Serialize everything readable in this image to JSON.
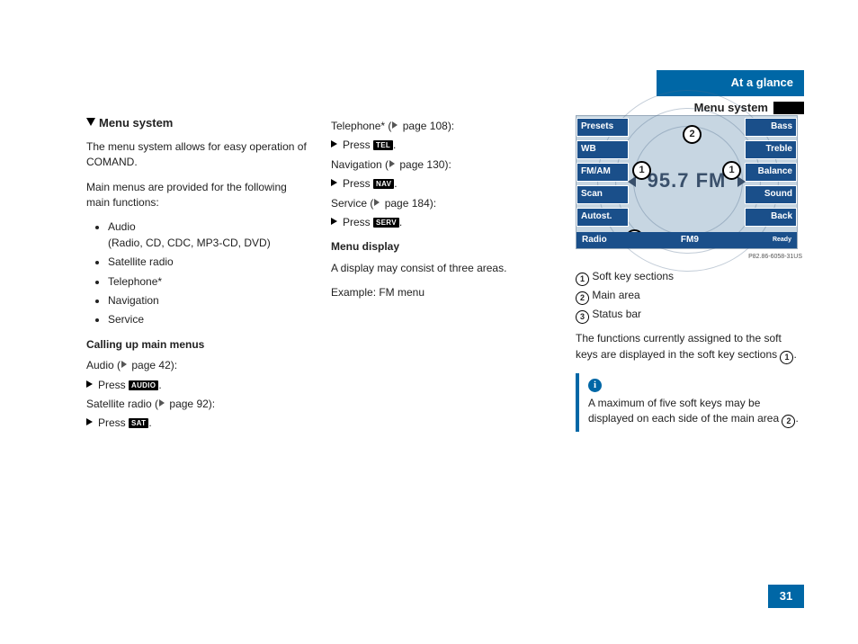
{
  "header": {
    "title": "At a glance",
    "subtitle": "Menu system"
  },
  "section": {
    "title": "Menu system",
    "intro": "The menu system allows for easy operation of COMAND.",
    "intro2": "Main menus are provided for the following main functions:",
    "functions": [
      "Audio",
      "Satellite radio",
      "Telephone*",
      "Navigation",
      "Service"
    ],
    "audio_sub": "(Radio, CD, CDC, MP3-CD, DVD)",
    "calling_title": "Calling up main menus",
    "calls": [
      {
        "label": "Audio",
        "page": "42",
        "key": "AUDIO"
      },
      {
        "label": "Satellite radio",
        "page": "92",
        "key": "SAT"
      },
      {
        "label": "Telephone*",
        "page": "108",
        "key": "TEL"
      },
      {
        "label": "Navigation",
        "page": "130",
        "key": "NAV"
      },
      {
        "label": "Service",
        "page": "184",
        "key": "SERV"
      }
    ],
    "press": "Press",
    "menu_display_title": "Menu display",
    "menu_display_text": "A display may consist of three areas.",
    "menu_display_example": "Example: FM menu"
  },
  "screen": {
    "left_keys": [
      "Presets",
      "WB",
      "FM/AM",
      "Scan",
      "Autost."
    ],
    "right_keys": [
      "Bass",
      "Treble",
      "Balance",
      "Sound",
      "Back"
    ],
    "frequency": "95.7 FM",
    "status_left": "Radio",
    "status_mid": "FM9",
    "status_right": "Ready",
    "img_ref": "P82.86-6058-31US"
  },
  "legend": {
    "items": [
      {
        "n": "1",
        "text": "Soft key sections"
      },
      {
        "n": "2",
        "text": "Main area"
      },
      {
        "n": "3",
        "text": "Status bar"
      }
    ],
    "para": "The functions currently assigned to the soft keys are displayed in the soft key sections",
    "info": "A maximum of five soft keys may be displayed on each side of the main area"
  },
  "page_number": "31"
}
